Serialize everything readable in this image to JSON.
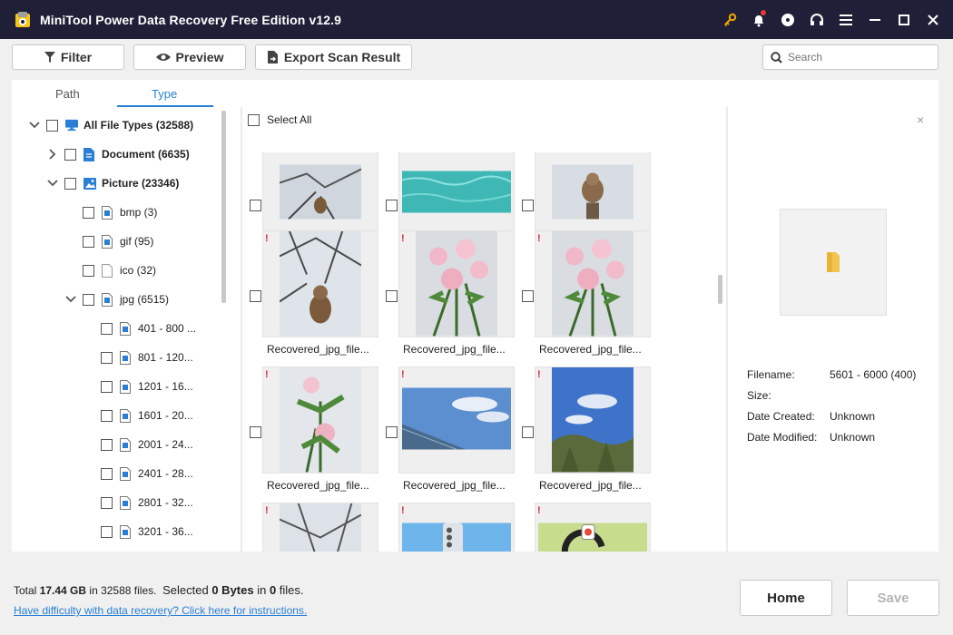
{
  "app": {
    "title": "MiniTool Power Data Recovery Free Edition v12.9"
  },
  "titlebar_icons": [
    "key-icon",
    "bell-icon",
    "disc-icon",
    "headset-icon",
    "menu-icon",
    "minimize-icon",
    "maximize-icon",
    "close-icon"
  ],
  "toolbar": {
    "filter_label": "Filter",
    "preview_label": "Preview",
    "export_label": "Export Scan Result",
    "search_placeholder": "Search"
  },
  "tabs": {
    "path": "Path",
    "type": "Type",
    "active": "Type"
  },
  "tree": [
    {
      "label": "All File Types (32588)",
      "bold": true,
      "icon": "monitor-icon",
      "expand": "down"
    },
    {
      "label": "Document (6635)",
      "bold": true,
      "icon": "document-icon",
      "expand": "right"
    },
    {
      "label": "Picture (23346)",
      "bold": true,
      "icon": "picture-icon",
      "expand": "down"
    },
    {
      "label": "bmp (3)",
      "icon": "file-icon"
    },
    {
      "label": "gif (95)",
      "icon": "file-icon"
    },
    {
      "label": "ico (32)",
      "icon": "blank-file-icon"
    },
    {
      "label": "jpg (6515)",
      "icon": "file-icon",
      "expand": "down"
    },
    {
      "label": "401 - 800 ...",
      "icon": "file-icon"
    },
    {
      "label": "801 - 120...",
      "icon": "file-icon"
    },
    {
      "label": "1201 - 16...",
      "icon": "file-icon"
    },
    {
      "label": "1601 - 20...",
      "icon": "file-icon"
    },
    {
      "label": "2001 - 24...",
      "icon": "file-icon"
    },
    {
      "label": "2401 - 28...",
      "icon": "file-icon"
    },
    {
      "label": "2801 - 32...",
      "icon": "file-icon"
    },
    {
      "label": "3201 - 36...",
      "icon": "file-icon"
    }
  ],
  "grid": {
    "select_all_label": "Select All",
    "files": [
      {
        "caption": "Recovered_jpg_file...",
        "warning": false,
        "thumb": "snow-monkey"
      },
      {
        "caption": "Recovered_jpg_file...",
        "warning": false,
        "thumb": "pool-water"
      },
      {
        "caption": "Recovered_jpg_file...",
        "warning": false,
        "thumb": "monkey-on-post"
      },
      {
        "caption": "Recovered_jpg_file...",
        "warning": true,
        "thumb": "monkey-snow-branches"
      },
      {
        "caption": "Recovered_jpg_file...",
        "warning": true,
        "thumb": "roses"
      },
      {
        "caption": "Recovered_jpg_file...",
        "warning": true,
        "thumb": "roses"
      },
      {
        "caption": "Recovered_jpg_file...",
        "warning": true,
        "thumb": "rose-bud"
      },
      {
        "caption": "Recovered_jpg_file...",
        "warning": true,
        "thumb": "sky-building"
      },
      {
        "caption": "Recovered_jpg_file...",
        "warning": true,
        "thumb": "sky-trees"
      },
      {
        "caption": "",
        "warning": true,
        "thumb": "snow-branches"
      },
      {
        "caption": "",
        "warning": true,
        "thumb": "phone-blue"
      },
      {
        "caption": "",
        "warning": true,
        "thumb": "green-sign"
      }
    ],
    "warning_mark": "!"
  },
  "preview": {
    "close_label": "×",
    "filename_label": "Filename:",
    "filename_value": "5601 - 6000 (400)",
    "size_label": "Size:",
    "size_value": "",
    "created_label": "Date Created:",
    "created_value": "Unknown",
    "modified_label": "Date Modified:",
    "modified_value": "Unknown"
  },
  "status": {
    "total_prefix": "Total ",
    "total_size": "17.44 GB",
    "in_text": " in ",
    "total_files": "32588",
    "files_text": " files.",
    "selected_prefix": "Selected ",
    "selected_size": "0 Bytes",
    "selected_in": " in ",
    "selected_files": "0",
    "selected_suffix": " files.",
    "help_link": "Have difficulty with data recovery? Click here for instructions."
  },
  "footer": {
    "home_label": "Home",
    "save_label": "Save"
  },
  "colors": {
    "titlebar": "#1f1f37",
    "accent": "#2a7fd4",
    "warning": "#d32f2f"
  }
}
